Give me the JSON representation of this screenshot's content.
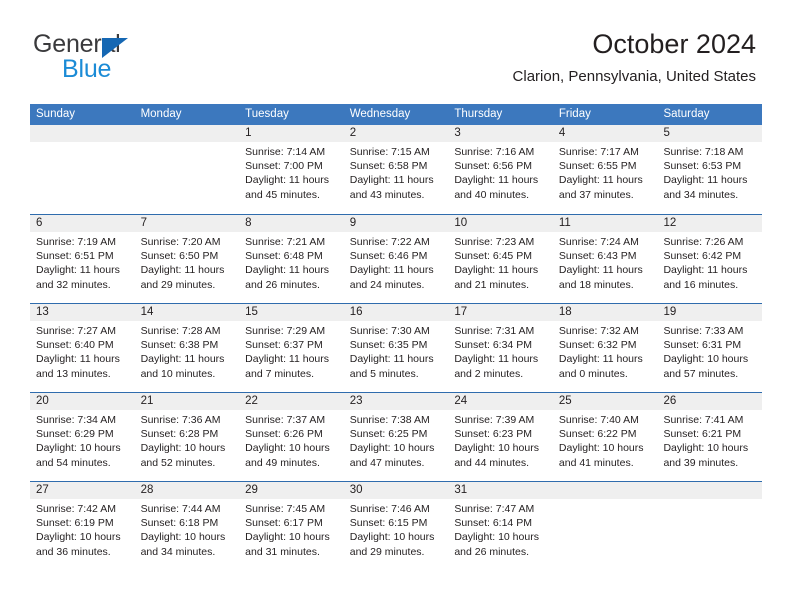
{
  "logo": {
    "word_one": "General",
    "word_two": "Blue",
    "triangle_icon": "blue-triangle-icon",
    "brand_dark": "#3a3a3c",
    "brand_blue": "#1b8bd6",
    "triangle_color": "#1567b3"
  },
  "header": {
    "title": "October 2024",
    "subtitle": "Clarion, Pennsylvania, United States"
  },
  "theme": {
    "header_band": "#3c78be",
    "row_rule": "#2f6cad",
    "date_band": "#efefef",
    "text": "#231f20"
  },
  "weekdays": [
    "Sunday",
    "Monday",
    "Tuesday",
    "Wednesday",
    "Thursday",
    "Friday",
    "Saturday"
  ],
  "weeks": [
    [
      {
        "date": "",
        "sunrise": "",
        "sunset": "",
        "daylight_line1": "",
        "daylight_line2": "",
        "empty": true
      },
      {
        "date": "",
        "sunrise": "",
        "sunset": "",
        "daylight_line1": "",
        "daylight_line2": "",
        "empty": true
      },
      {
        "date": "1",
        "sunrise": "Sunrise: 7:14 AM",
        "sunset": "Sunset: 7:00 PM",
        "daylight_line1": "Daylight: 11 hours",
        "daylight_line2": "and 45 minutes."
      },
      {
        "date": "2",
        "sunrise": "Sunrise: 7:15 AM",
        "sunset": "Sunset: 6:58 PM",
        "daylight_line1": "Daylight: 11 hours",
        "daylight_line2": "and 43 minutes."
      },
      {
        "date": "3",
        "sunrise": "Sunrise: 7:16 AM",
        "sunset": "Sunset: 6:56 PM",
        "daylight_line1": "Daylight: 11 hours",
        "daylight_line2": "and 40 minutes."
      },
      {
        "date": "4",
        "sunrise": "Sunrise: 7:17 AM",
        "sunset": "Sunset: 6:55 PM",
        "daylight_line1": "Daylight: 11 hours",
        "daylight_line2": "and 37 minutes."
      },
      {
        "date": "5",
        "sunrise": "Sunrise: 7:18 AM",
        "sunset": "Sunset: 6:53 PM",
        "daylight_line1": "Daylight: 11 hours",
        "daylight_line2": "and 34 minutes."
      }
    ],
    [
      {
        "date": "6",
        "sunrise": "Sunrise: 7:19 AM",
        "sunset": "Sunset: 6:51 PM",
        "daylight_line1": "Daylight: 11 hours",
        "daylight_line2": "and 32 minutes."
      },
      {
        "date": "7",
        "sunrise": "Sunrise: 7:20 AM",
        "sunset": "Sunset: 6:50 PM",
        "daylight_line1": "Daylight: 11 hours",
        "daylight_line2": "and 29 minutes."
      },
      {
        "date": "8",
        "sunrise": "Sunrise: 7:21 AM",
        "sunset": "Sunset: 6:48 PM",
        "daylight_line1": "Daylight: 11 hours",
        "daylight_line2": "and 26 minutes."
      },
      {
        "date": "9",
        "sunrise": "Sunrise: 7:22 AM",
        "sunset": "Sunset: 6:46 PM",
        "daylight_line1": "Daylight: 11 hours",
        "daylight_line2": "and 24 minutes."
      },
      {
        "date": "10",
        "sunrise": "Sunrise: 7:23 AM",
        "sunset": "Sunset: 6:45 PM",
        "daylight_line1": "Daylight: 11 hours",
        "daylight_line2": "and 21 minutes."
      },
      {
        "date": "11",
        "sunrise": "Sunrise: 7:24 AM",
        "sunset": "Sunset: 6:43 PM",
        "daylight_line1": "Daylight: 11 hours",
        "daylight_line2": "and 18 minutes."
      },
      {
        "date": "12",
        "sunrise": "Sunrise: 7:26 AM",
        "sunset": "Sunset: 6:42 PM",
        "daylight_line1": "Daylight: 11 hours",
        "daylight_line2": "and 16 minutes."
      }
    ],
    [
      {
        "date": "13",
        "sunrise": "Sunrise: 7:27 AM",
        "sunset": "Sunset: 6:40 PM",
        "daylight_line1": "Daylight: 11 hours",
        "daylight_line2": "and 13 minutes."
      },
      {
        "date": "14",
        "sunrise": "Sunrise: 7:28 AM",
        "sunset": "Sunset: 6:38 PM",
        "daylight_line1": "Daylight: 11 hours",
        "daylight_line2": "and 10 minutes."
      },
      {
        "date": "15",
        "sunrise": "Sunrise: 7:29 AM",
        "sunset": "Sunset: 6:37 PM",
        "daylight_line1": "Daylight: 11 hours",
        "daylight_line2": "and 7 minutes."
      },
      {
        "date": "16",
        "sunrise": "Sunrise: 7:30 AM",
        "sunset": "Sunset: 6:35 PM",
        "daylight_line1": "Daylight: 11 hours",
        "daylight_line2": "and 5 minutes."
      },
      {
        "date": "17",
        "sunrise": "Sunrise: 7:31 AM",
        "sunset": "Sunset: 6:34 PM",
        "daylight_line1": "Daylight: 11 hours",
        "daylight_line2": "and 2 minutes."
      },
      {
        "date": "18",
        "sunrise": "Sunrise: 7:32 AM",
        "sunset": "Sunset: 6:32 PM",
        "daylight_line1": "Daylight: 11 hours",
        "daylight_line2": "and 0 minutes."
      },
      {
        "date": "19",
        "sunrise": "Sunrise: 7:33 AM",
        "sunset": "Sunset: 6:31 PM",
        "daylight_line1": "Daylight: 10 hours",
        "daylight_line2": "and 57 minutes."
      }
    ],
    [
      {
        "date": "20",
        "sunrise": "Sunrise: 7:34 AM",
        "sunset": "Sunset: 6:29 PM",
        "daylight_line1": "Daylight: 10 hours",
        "daylight_line2": "and 54 minutes."
      },
      {
        "date": "21",
        "sunrise": "Sunrise: 7:36 AM",
        "sunset": "Sunset: 6:28 PM",
        "daylight_line1": "Daylight: 10 hours",
        "daylight_line2": "and 52 minutes."
      },
      {
        "date": "22",
        "sunrise": "Sunrise: 7:37 AM",
        "sunset": "Sunset: 6:26 PM",
        "daylight_line1": "Daylight: 10 hours",
        "daylight_line2": "and 49 minutes."
      },
      {
        "date": "23",
        "sunrise": "Sunrise: 7:38 AM",
        "sunset": "Sunset: 6:25 PM",
        "daylight_line1": "Daylight: 10 hours",
        "daylight_line2": "and 47 minutes."
      },
      {
        "date": "24",
        "sunrise": "Sunrise: 7:39 AM",
        "sunset": "Sunset: 6:23 PM",
        "daylight_line1": "Daylight: 10 hours",
        "daylight_line2": "and 44 minutes."
      },
      {
        "date": "25",
        "sunrise": "Sunrise: 7:40 AM",
        "sunset": "Sunset: 6:22 PM",
        "daylight_line1": "Daylight: 10 hours",
        "daylight_line2": "and 41 minutes."
      },
      {
        "date": "26",
        "sunrise": "Sunrise: 7:41 AM",
        "sunset": "Sunset: 6:21 PM",
        "daylight_line1": "Daylight: 10 hours",
        "daylight_line2": "and 39 minutes."
      }
    ],
    [
      {
        "date": "27",
        "sunrise": "Sunrise: 7:42 AM",
        "sunset": "Sunset: 6:19 PM",
        "daylight_line1": "Daylight: 10 hours",
        "daylight_line2": "and 36 minutes."
      },
      {
        "date": "28",
        "sunrise": "Sunrise: 7:44 AM",
        "sunset": "Sunset: 6:18 PM",
        "daylight_line1": "Daylight: 10 hours",
        "daylight_line2": "and 34 minutes."
      },
      {
        "date": "29",
        "sunrise": "Sunrise: 7:45 AM",
        "sunset": "Sunset: 6:17 PM",
        "daylight_line1": "Daylight: 10 hours",
        "daylight_line2": "and 31 minutes."
      },
      {
        "date": "30",
        "sunrise": "Sunrise: 7:46 AM",
        "sunset": "Sunset: 6:15 PM",
        "daylight_line1": "Daylight: 10 hours",
        "daylight_line2": "and 29 minutes."
      },
      {
        "date": "31",
        "sunrise": "Sunrise: 7:47 AM",
        "sunset": "Sunset: 6:14 PM",
        "daylight_line1": "Daylight: 10 hours",
        "daylight_line2": "and 26 minutes."
      },
      {
        "date": "",
        "sunrise": "",
        "sunset": "",
        "daylight_line1": "",
        "daylight_line2": "",
        "empty": true
      },
      {
        "date": "",
        "sunrise": "",
        "sunset": "",
        "daylight_line1": "",
        "daylight_line2": "",
        "empty": true
      }
    ]
  ]
}
